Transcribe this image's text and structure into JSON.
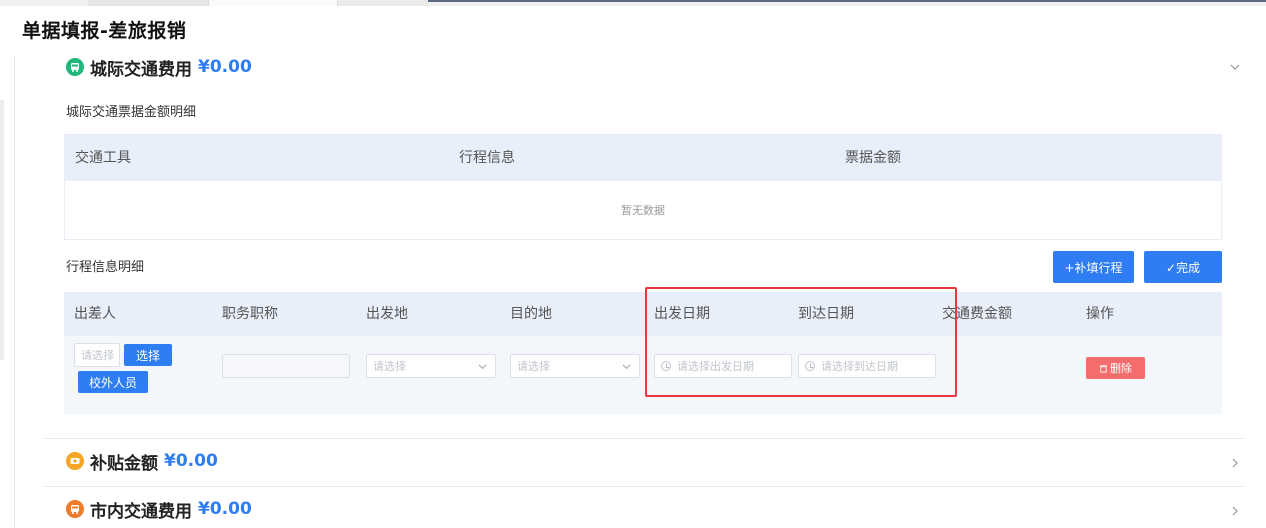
{
  "page_title": "单据填报-差旅报销",
  "intercity": {
    "title": "城际交通费用",
    "amount": "¥0.00",
    "ticket_label": "城际交通票据金额明细",
    "ticket_columns": [
      "交通工具",
      "行程信息",
      "票据金额"
    ],
    "empty_text": "暂无数据",
    "trip_label": "行程信息明细",
    "add_trip_button": "+补填行程",
    "done_button": "✓完成",
    "trip_columns": [
      "出差人",
      "职务职称",
      "出发地",
      "目的地",
      "出发日期",
      "到达日期",
      "交通费金额",
      "操作"
    ],
    "row": {
      "traveler_placeholder": "请选择",
      "select_button": "选择",
      "external_button": "校外人员",
      "depart_place_placeholder": "请选择",
      "dest_place_placeholder": "请选择",
      "depart_date_placeholder": "请选择出发日期",
      "arrive_date_placeholder": "请选择到达日期",
      "delete_button": "删除"
    }
  },
  "subsidy": {
    "title": "补贴金额",
    "amount": "¥0.00"
  },
  "citytransport": {
    "title": "市内交通费用",
    "amount": "¥0.00"
  },
  "colors": {
    "accent": "#2e7df2",
    "green": "#1fb87a",
    "orange": "#f5a623",
    "danger": "#f56c6c",
    "highlight": "#e8383d"
  }
}
